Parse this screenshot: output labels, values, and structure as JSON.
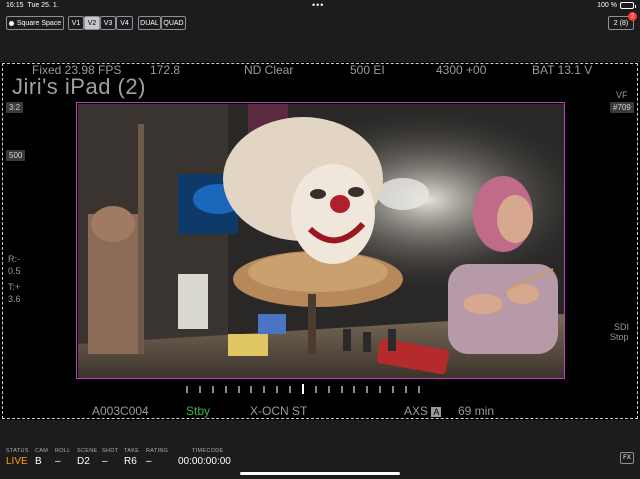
{
  "statusbar": {
    "time": "16:15",
    "date": "Tue 25. 1.",
    "more": "•••",
    "battery": "100 %"
  },
  "toolbar": {
    "square_space": "Square Space",
    "views": [
      "V1",
      "V2",
      "V3",
      "V4"
    ],
    "active_view": "V2",
    "dual": "DUAL",
    "quad": "QUAD",
    "stream_count": "2 (8)",
    "badge": "2"
  },
  "hud": {
    "fps": "Fixed 23.98 FPS",
    "shutter": "172.8",
    "nd": "ND Clear",
    "ei": "500 EI",
    "wb": "4300 +00",
    "battery": "BAT 13.1 V",
    "device": "Jiri's iPad (2)",
    "aspect": "3:2",
    "left_pill": "500",
    "iris": "R:-",
    "iris_val": "0.5",
    "tint": "T:+",
    "tint_val": "3.6",
    "vf": "VF",
    "vf_pill": "#709",
    "sdi": "SDI",
    "sdi_state": "Stop",
    "clip": "A003C004",
    "stby": "Stby",
    "codec": "X-OCN ST",
    "media": "AXS",
    "media_slot": "A",
    "remaining": "69 min"
  },
  "bottom": {
    "status_label": "STATUS",
    "status": "LIVE",
    "cam_label": "CAM",
    "cam": "B",
    "roll_label": "ROLL",
    "roll": "–",
    "scene_label": "SCENE",
    "scene": "D2",
    "shot_label": "SHOT",
    "shot": "–",
    "take_label": "TAKE",
    "take": "R6",
    "rating_label": "RATING",
    "rating": "–",
    "tc_label": "TIMECODE",
    "timecode": "00:00:00:00",
    "fx": "FX"
  },
  "colors": {
    "frameline": "#c03cc0",
    "live": "#ff9f0a",
    "stby": "#36b34a",
    "badge": "#ff3b30"
  }
}
